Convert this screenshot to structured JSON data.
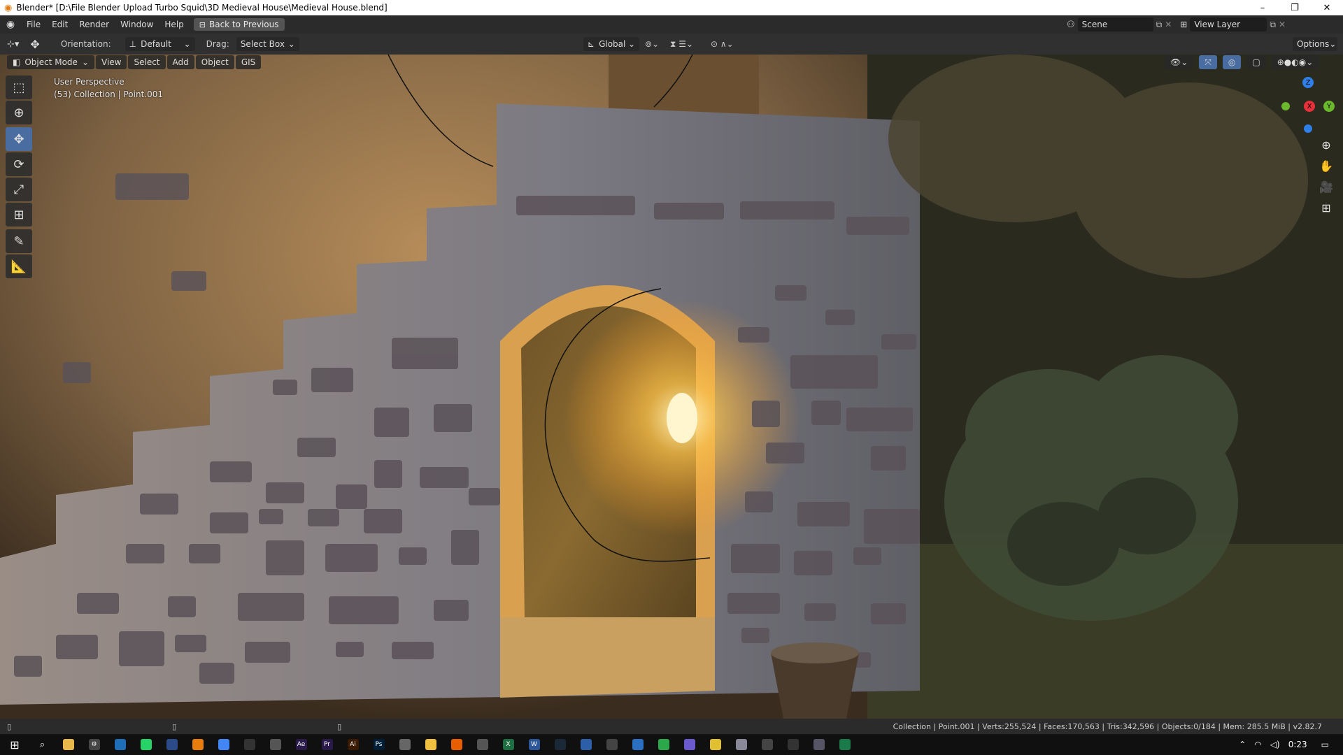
{
  "window": {
    "title": "Blender* [D:\\File Blender Upload Turbo Squid\\3D Medieval House\\Medieval House.blend]",
    "controls": {
      "minimize": "–",
      "maximize": "❐",
      "close": "✕"
    }
  },
  "menu": {
    "items": [
      "File",
      "Edit",
      "Render",
      "Window",
      "Help"
    ],
    "back_button": "Back to Previous",
    "scene_name": "Scene",
    "view_layer": "View Layer"
  },
  "toolhdr": {
    "orientation_label": "Orientation:",
    "orientation_value": "Default",
    "drag_label": "Drag:",
    "drag_value": "Select Box",
    "transform_orientation": "Global",
    "options": "Options"
  },
  "viewport_header": {
    "mode": "Object Mode",
    "items": [
      "View",
      "Select",
      "Add",
      "Object",
      "GIS"
    ]
  },
  "overlay": {
    "perspective": "User Perspective",
    "collection_info": "(53) Collection | Point.001"
  },
  "gizmo": {
    "z": "Z",
    "x": "X",
    "y": "Y"
  },
  "status": {
    "text": "Collection | Point.001 | Verts:255,524 | Faces:170,563 | Tris:342,596 | Objects:0/184 | Mem: 285.5 MiB | v2.82.7"
  },
  "taskbar": {
    "time": "0:23",
    "apps": [
      {
        "name": "file-explorer",
        "color": "#e8b84a",
        "label": ""
      },
      {
        "name": "settings",
        "color": "#444",
        "label": "⚙"
      },
      {
        "name": "app-blue",
        "color": "#1e6fb8",
        "label": ""
      },
      {
        "name": "whatsapp",
        "color": "#25d366",
        "label": ""
      },
      {
        "name": "app-dark",
        "color": "#2b4a8a",
        "label": ""
      },
      {
        "name": "blender",
        "color": "#e87d0d",
        "label": ""
      },
      {
        "name": "chrome",
        "color": "#4285f4",
        "label": ""
      },
      {
        "name": "terminal",
        "color": "#333",
        "label": ""
      },
      {
        "name": "app-tool",
        "color": "#555",
        "label": ""
      },
      {
        "name": "after-effects",
        "color": "#2a1a4a",
        "label": "Ae"
      },
      {
        "name": "premiere",
        "color": "#2a1a4a",
        "label": "Pr"
      },
      {
        "name": "illustrator",
        "color": "#3a1a00",
        "label": "Ai"
      },
      {
        "name": "photoshop",
        "color": "#001e36",
        "label": "Ps"
      },
      {
        "name": "app-gray",
        "color": "#666",
        "label": ""
      },
      {
        "name": "app-yellow",
        "color": "#f0c040",
        "label": ""
      },
      {
        "name": "vlc",
        "color": "#e85d00",
        "label": ""
      },
      {
        "name": "app-circle",
        "color": "#555",
        "label": ""
      },
      {
        "name": "excel",
        "color": "#1d6f42",
        "label": "X"
      },
      {
        "name": "word",
        "color": "#2b579a",
        "label": "W"
      },
      {
        "name": "steam",
        "color": "#1b2838",
        "label": ""
      },
      {
        "name": "app-blue2",
        "color": "#2d5fa8",
        "label": ""
      },
      {
        "name": "app-ring",
        "color": "#444",
        "label": ""
      },
      {
        "name": "app-box",
        "color": "#2a6fc0",
        "label": ""
      },
      {
        "name": "app-green",
        "color": "#2aa84a",
        "label": ""
      },
      {
        "name": "app-purple",
        "color": "#6a5acd",
        "label": ""
      },
      {
        "name": "app-yellow2",
        "color": "#e0c030",
        "label": ""
      },
      {
        "name": "app-file",
        "color": "#889",
        "label": ""
      },
      {
        "name": "calculator",
        "color": "#444",
        "label": ""
      },
      {
        "name": "app-shield",
        "color": "#333",
        "label": ""
      },
      {
        "name": "app-window",
        "color": "#556",
        "label": ""
      },
      {
        "name": "app-active",
        "color": "#1a7a4a",
        "label": ""
      }
    ]
  }
}
